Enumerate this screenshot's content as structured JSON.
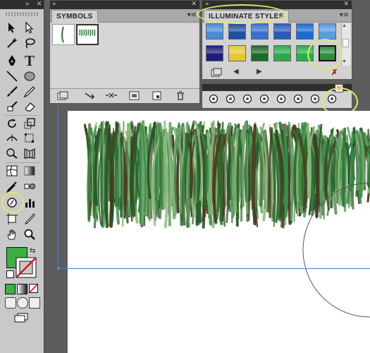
{
  "toolbox": {
    "top_arrows": "»",
    "close": "✕",
    "tools": [
      {
        "name": "selection-tool",
        "icon": "arrow-icon"
      },
      {
        "name": "direct-selection-tool",
        "icon": "white-arrow-icon"
      },
      {
        "name": "magic-wand-tool",
        "icon": "wand-icon"
      },
      {
        "name": "lasso-tool",
        "icon": "lasso-icon"
      },
      {
        "name": "pen-tool",
        "icon": "pen-icon"
      },
      {
        "name": "type-tool",
        "icon": "type-icon",
        "glyph": "T"
      },
      {
        "name": "line-tool",
        "icon": "line-icon"
      },
      {
        "name": "ellipse-tool",
        "icon": "ellipse-icon"
      },
      {
        "name": "paintbrush-tool",
        "icon": "brush-icon"
      },
      {
        "name": "pencil-tool",
        "icon": "pencil-icon"
      },
      {
        "name": "blob-brush-tool",
        "icon": "blob-brush-icon"
      },
      {
        "name": "eraser-tool",
        "icon": "eraser-icon"
      },
      {
        "name": "rotate-tool",
        "icon": "rotate-icon"
      },
      {
        "name": "scale-tool",
        "icon": "scale-icon"
      },
      {
        "name": "width-tool",
        "icon": "width-icon"
      },
      {
        "name": "free-transform-tool",
        "icon": "free-transform-icon"
      },
      {
        "name": "shape-builder-tool",
        "icon": "shape-builder-icon"
      },
      {
        "name": "perspective-grid-tool",
        "icon": "perspective-icon"
      },
      {
        "name": "mesh-tool",
        "icon": "mesh-icon"
      },
      {
        "name": "gradient-tool",
        "icon": "gradient-icon"
      },
      {
        "name": "eyedropper-tool",
        "icon": "eyedropper-icon"
      },
      {
        "name": "blend-tool",
        "icon": "blend-icon"
      },
      {
        "name": "symbol-sprayer-tool",
        "icon": "symbol-sprayer-icon"
      },
      {
        "name": "column-graph-tool",
        "icon": "graph-icon"
      },
      {
        "name": "artboard-tool",
        "icon": "artboard-icon"
      },
      {
        "name": "slice-tool",
        "icon": "slice-icon"
      },
      {
        "name": "hand-tool",
        "icon": "hand-icon"
      },
      {
        "name": "zoom-tool",
        "icon": "zoom-icon"
      }
    ],
    "fill_color": "#3cb043",
    "stroke_color": "none"
  },
  "symbols_panel": {
    "top_arrows": "«",
    "close": "✕",
    "title": "SYMBOLS",
    "menu_icon": "panel-menu-icon"
  },
  "illuminate_panel": {
    "top_arrows": "»",
    "close": "✕",
    "title": "ILLUMINATE STYLES",
    "menu_icon": "panel-menu-icon",
    "swatches_row1": [
      "#4a8bd8",
      "#1f4fa0",
      "#3a6fcf",
      "#2c5bb6",
      "#1a6bd0",
      "#5a9ae0"
    ],
    "swatches_row2": [
      "#1c1c7a",
      "#e8c830",
      "#1e6a2a",
      "#2fa84a",
      "#22b04a",
      "#2e8f3e"
    ]
  },
  "accent": "#e2e86a",
  "guide_color": "#4a7fd7"
}
